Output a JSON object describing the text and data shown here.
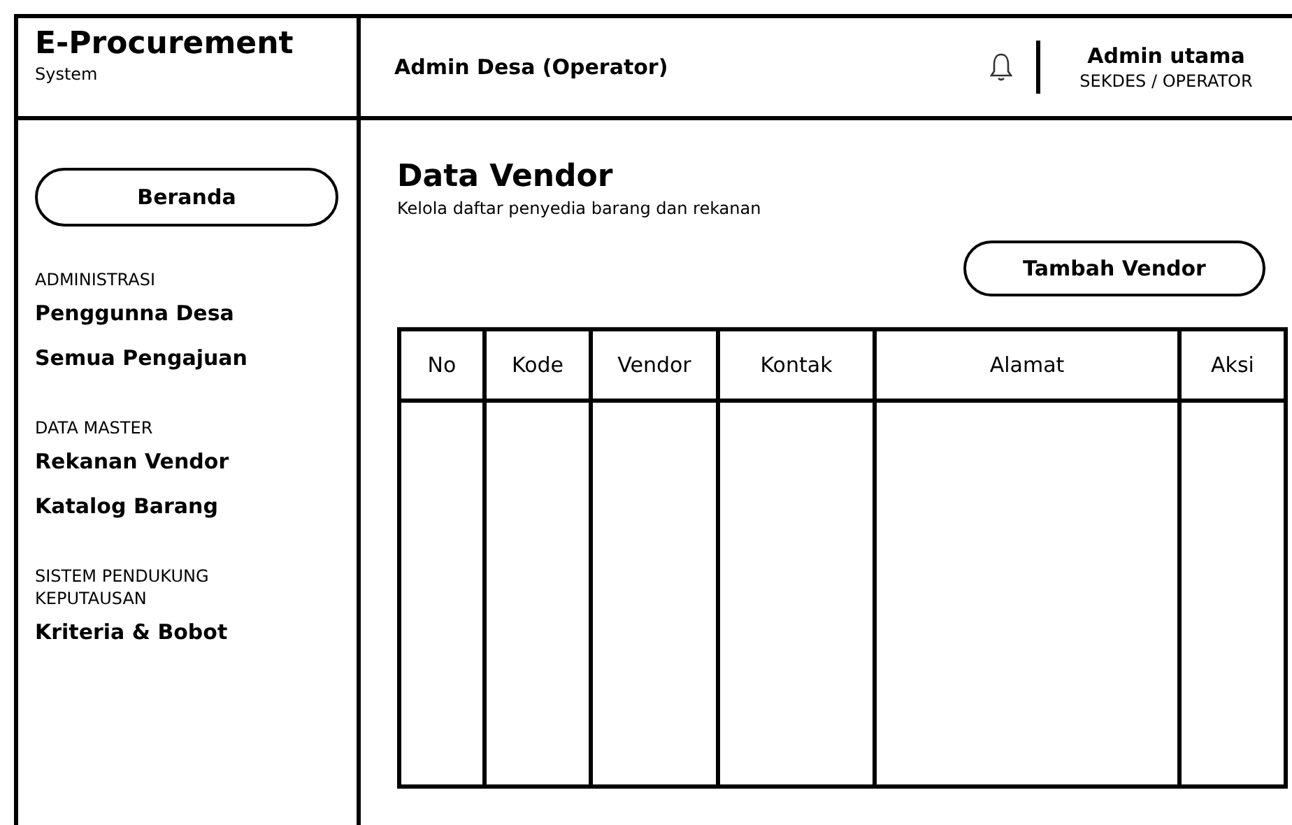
{
  "brand": {
    "title": "E-Procurement",
    "subtitle": "System"
  },
  "header": {
    "title": "Admin Desa (Operator)",
    "user_name": "Admin utama",
    "user_role": "SEKDES / OPERATOR"
  },
  "sidebar": {
    "home": "Beranda",
    "sections": [
      {
        "heading": "ADMINISTRASI",
        "items": [
          "Penggunna Desa",
          "Semua Pengajuan"
        ]
      },
      {
        "heading": "DATA MASTER",
        "items": [
          "Rekanan Vendor",
          "Katalog Barang"
        ]
      },
      {
        "heading": "SISTEM PENDUKUNG KEPUTAUSAN",
        "items": [
          "Kriteria & Bobot"
        ]
      }
    ]
  },
  "page": {
    "title": "Data Vendor",
    "subtitle": "Kelola daftar penyedia barang dan rekanan",
    "add_button": "Tambah Vendor"
  },
  "table": {
    "columns": [
      "No",
      "Kode",
      "Vendor",
      "Kontak",
      "Alamat",
      "Aksi"
    ]
  }
}
